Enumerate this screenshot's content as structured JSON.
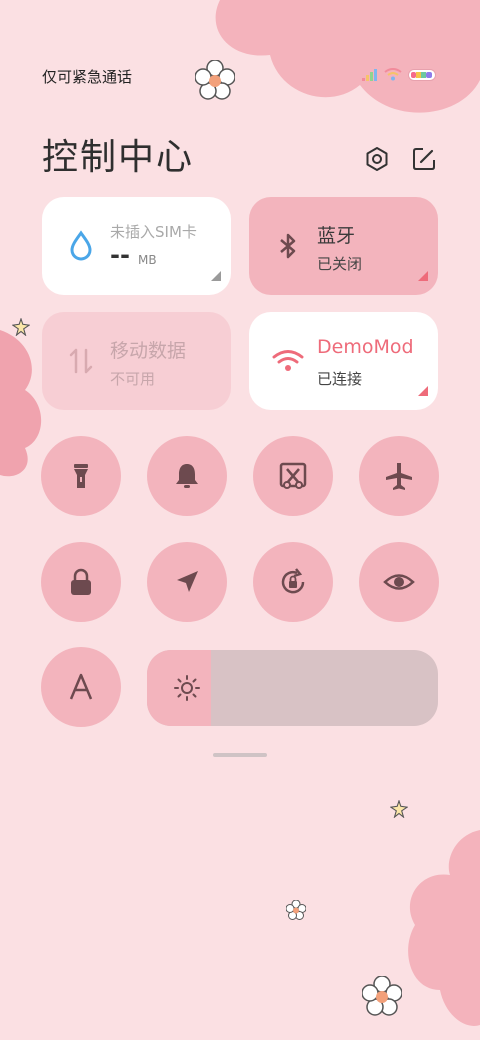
{
  "status_bar": {
    "carrier_text": "仅可紧急通话",
    "signal_icon": "signal-icon",
    "wifi_icon": "wifi-icon",
    "battery_icon": "battery-icon"
  },
  "header": {
    "title": "控制中心",
    "settings_icon": "gear-icon",
    "edit_icon": "edit-icon"
  },
  "tiles": {
    "data_usage": {
      "title": "未插入SIM卡",
      "value": "--",
      "unit": "MB",
      "icon": "water-drop-icon"
    },
    "bluetooth": {
      "title": "蓝牙",
      "status": "已关闭",
      "icon": "bluetooth-icon"
    },
    "mobile_data": {
      "title": "移动数据",
      "status": "不可用",
      "icon": "data-arrows-icon"
    },
    "wifi": {
      "title": "DemoMod",
      "status": "已连接",
      "icon": "wifi-icon"
    }
  },
  "toggles_row1": [
    "flashlight-icon",
    "bell-icon",
    "screenshot-icon",
    "airplane-icon"
  ],
  "toggles_row2": [
    "lock-icon",
    "location-icon",
    "rotation-lock-icon",
    "eye-icon"
  ],
  "toggles_row3": [
    "font-size-icon"
  ],
  "brightness": {
    "level": 0.22,
    "icon": "sun-icon"
  },
  "colors": {
    "background": "#fbe0e3",
    "tile_active": "#f3b4bd",
    "tile_white": "#ffffff",
    "tile_disabled": "#f7ced4",
    "accent_wifi": "#ee6b7a",
    "accent_drop": "#4aa6e8",
    "icon_dark": "#6d4a4f"
  }
}
